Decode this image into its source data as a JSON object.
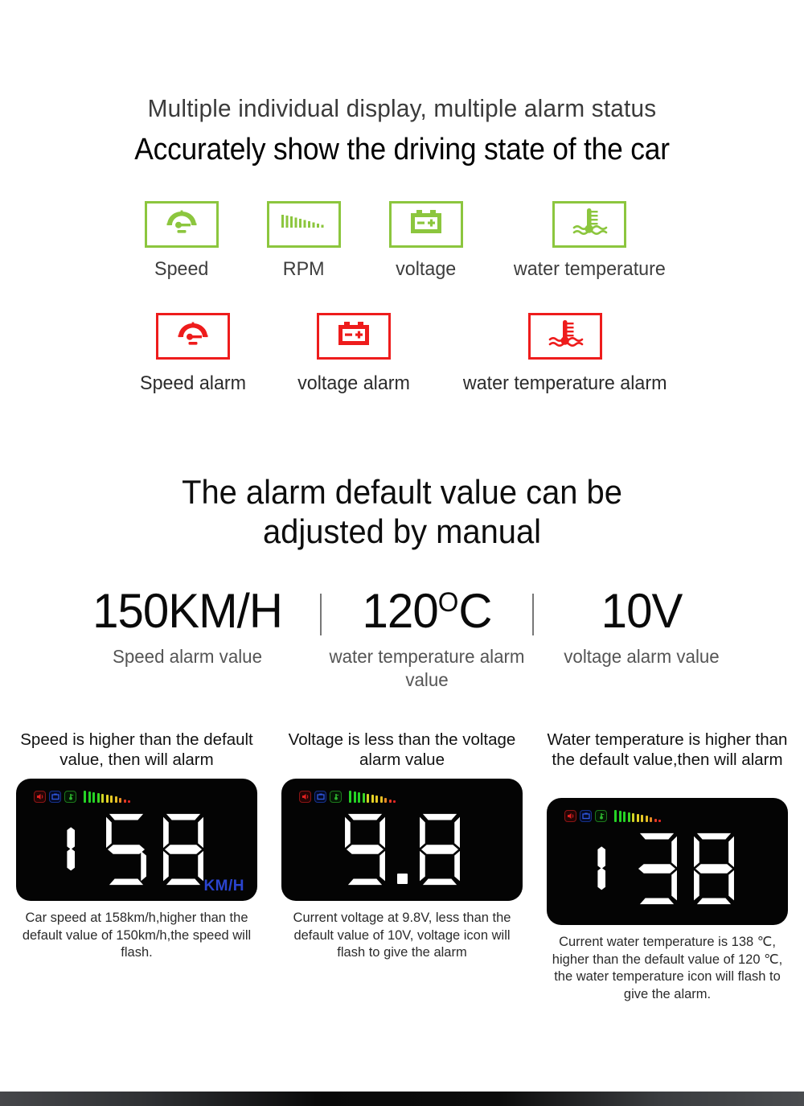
{
  "header": {
    "subtitle": "Multiple individual display, multiple alarm status",
    "title": "Accurately show the driving state of the car"
  },
  "colors": {
    "green": "#8cc63e",
    "red": "#ee1c1c",
    "blue_unit": "#2a44cf"
  },
  "status_icons": [
    {
      "icon": "speedometer-icon",
      "label": "Speed"
    },
    {
      "icon": "rpm-bars-icon",
      "label": "RPM"
    },
    {
      "icon": "battery-icon",
      "label": "voltage"
    },
    {
      "icon": "water-temperature-icon",
      "label": "water temperature"
    }
  ],
  "alarm_icons": [
    {
      "icon": "speedometer-icon",
      "label": "Speed alarm"
    },
    {
      "icon": "battery-icon",
      "label": "voltage alarm"
    },
    {
      "icon": "water-temperature-icon",
      "label": "water temperature alarm"
    }
  ],
  "mid_heading": {
    "line1": "The alarm default value can be",
    "line2": "adjusted by manual"
  },
  "alarm_values": [
    {
      "value": "150KM/H",
      "label": "Speed alarm value"
    },
    {
      "value_prefix": "120",
      "value_suffix": "C",
      "degree": "O",
      "label": "water temperature alarm value"
    },
    {
      "value": "10V",
      "label": "voltage alarm value"
    }
  ],
  "panels": [
    {
      "title": "Speed is higher than the default value, then will alarm",
      "display_value": "158",
      "unit": "KM/H",
      "caption": "Car speed at 158km/h,higher than the default value of 150km/h,the speed will flash."
    },
    {
      "title": "Voltage is less than the voltage alarm value",
      "display_value": "9.8",
      "unit": "",
      "caption": "Current voltage at 9.8V, less than the default value of 10V, voltage icon will flash to give the alarm"
    },
    {
      "title": "Water temperature is higher than the default value,then will alarm",
      "display_value": "138",
      "unit": "",
      "caption": "Current water temperature is 138 ℃, higher than the default value of 120 ℃, the water temperature icon will flash to give the alarm."
    }
  ]
}
